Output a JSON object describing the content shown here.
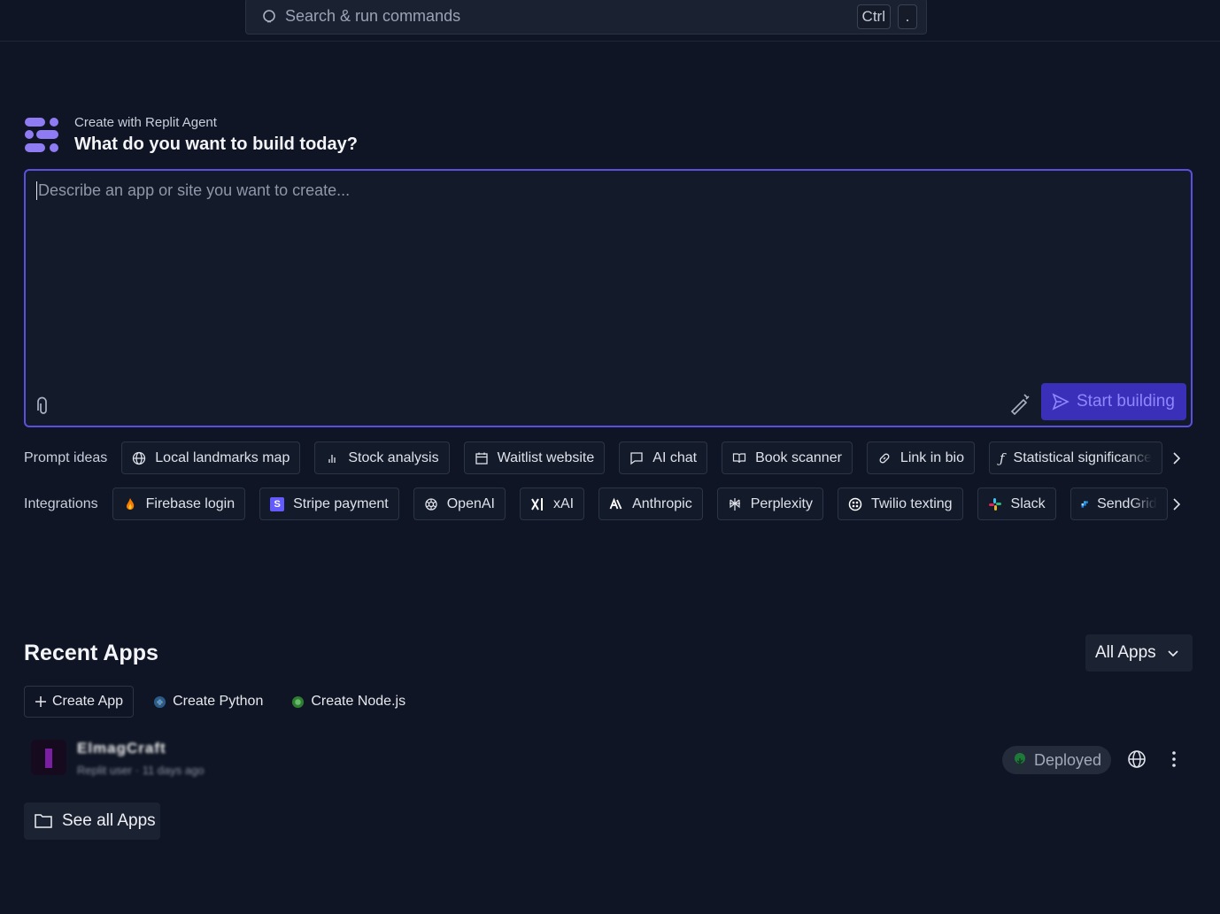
{
  "search": {
    "placeholder": "Search & run commands",
    "shortcut_keys": [
      "Ctrl",
      "."
    ]
  },
  "agent": {
    "subtitle": "Create with Replit Agent",
    "title": "What do you want to build today?",
    "prompt_placeholder": "Describe an app or site you want to create...",
    "start_label": "Start building",
    "accent_color": "#5b4fe0"
  },
  "prompt_ideas": {
    "label": "Prompt ideas",
    "items": [
      {
        "label": "Local landmarks map",
        "icon": "globe-icon"
      },
      {
        "label": "Stock analysis",
        "icon": "bar-chart-icon"
      },
      {
        "label": "Waitlist website",
        "icon": "calendar-icon"
      },
      {
        "label": "AI chat",
        "icon": "chat-bubble-icon"
      },
      {
        "label": "Book scanner",
        "icon": "open-book-icon"
      },
      {
        "label": "Link in bio",
        "icon": "link-icon"
      },
      {
        "label": "Statistical significance",
        "icon": "function-icon"
      }
    ]
  },
  "integrations": {
    "label": "Integrations",
    "items": [
      {
        "label": "Firebase login",
        "icon": "firebase-icon"
      },
      {
        "label": "Stripe payment",
        "icon": "stripe-icon"
      },
      {
        "label": "OpenAI",
        "icon": "openai-icon"
      },
      {
        "label": "xAI",
        "icon": "xai-icon"
      },
      {
        "label": "Anthropic",
        "icon": "anthropic-icon"
      },
      {
        "label": "Perplexity",
        "icon": "perplexity-icon"
      },
      {
        "label": "Twilio texting",
        "icon": "twilio-icon"
      },
      {
        "label": "Slack",
        "icon": "slack-icon"
      },
      {
        "label": "SendGrid",
        "icon": "sendgrid-icon"
      }
    ]
  },
  "recent": {
    "title": "Recent Apps",
    "filter_label": "All Apps",
    "create_app": "Create App",
    "create_python": "Create Python",
    "create_node": "Create Node.js",
    "apps": [
      {
        "name": "ElmagCraft",
        "meta": "Replit user · 11 days ago",
        "status": "Deployed"
      }
    ],
    "see_all": "See all Apps"
  }
}
